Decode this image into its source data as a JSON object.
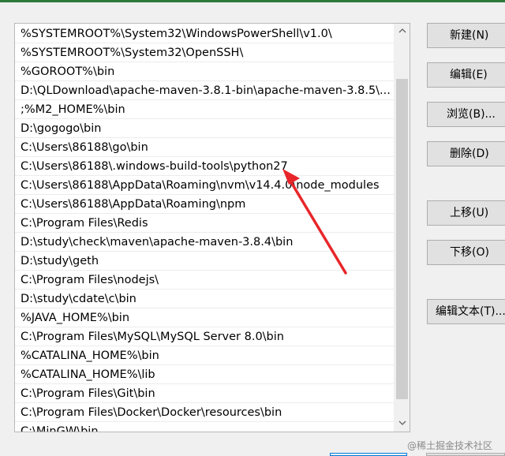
{
  "path_entries": [
    "%SYSTEMROOT%\\System32\\WindowsPowerShell\\v1.0\\",
    "%SYSTEMROOT%\\System32\\OpenSSH\\",
    "%GOROOT%\\bin",
    "D:\\QLDownload\\apache-maven-3.8.1-bin\\apache-maven-3.8.5\\...",
    ";%M2_HOME%\\bin",
    "D:\\gogogo\\bin",
    "C:\\Users\\86188\\go\\bin",
    "C:\\Users\\86188\\.windows-build-tools\\python27",
    "C:\\Users\\86188\\AppData\\Roaming\\nvm\\v14.4.0\\node_modules",
    "C:\\Users\\86188\\AppData\\Roaming\\npm",
    "C:\\Program Files\\Redis",
    "D:\\study\\check\\maven\\apache-maven-3.8.4\\bin",
    "D:\\study\\geth",
    "C:\\Program Files\\nodejs\\",
    "D:\\study\\cdate\\c\\bin",
    "%JAVA_HOME%\\bin",
    "C:\\Program Files\\MySQL\\MySQL Server 8.0\\bin",
    "%CATALINA_HOME%\\bin",
    "%CATALINA_HOME%\\lib",
    "C:\\Program Files\\Git\\bin",
    "C:\\Program Files\\Docker\\Docker\\resources\\bin",
    "C:\\MinGW\\bin"
  ],
  "buttons": {
    "new": "新建(N)",
    "edit": "编辑(E)",
    "browse": "浏览(B)...",
    "delete": "删除(D)",
    "move_up": "上移(U)",
    "move_down": "下移(O)",
    "edit_text": "编辑文本(T)..."
  },
  "icons": {
    "scroll_up": "chevron-up-icon",
    "scroll_down": "chevron-down-icon"
  },
  "annotation": {
    "arrow_color": "#e8262a"
  },
  "watermark": "@稀土掘金技术社区"
}
